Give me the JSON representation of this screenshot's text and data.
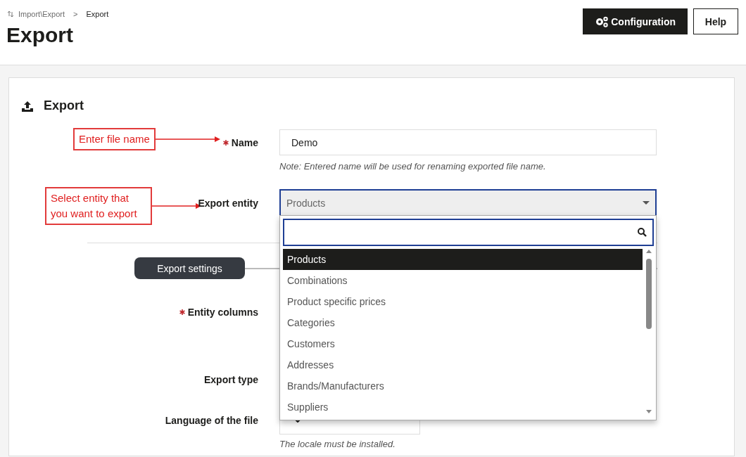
{
  "breadcrumb": {
    "parent": "Import\\Export",
    "separator": ">",
    "current": "Export"
  },
  "page_title": "Export",
  "header_buttons": [
    {
      "label": "Configuration",
      "kind": "primary"
    },
    {
      "label": "Help",
      "kind": "secondary"
    }
  ],
  "card": {
    "title": "Export"
  },
  "annotations": [
    {
      "text": "Enter file name"
    },
    {
      "text": "Select entity that you want to export"
    }
  ],
  "form": {
    "name": {
      "label": "Name",
      "required": true,
      "value": "Demo",
      "note": "Note: Entered name will be used for renaming exported file name."
    },
    "export_entity": {
      "label": "Export entity",
      "required": false,
      "value": "Products",
      "expanded": true,
      "options": [
        {
          "label": "Products",
          "selected": true
        },
        {
          "label": "Combinations",
          "selected": false
        },
        {
          "label": "Product specific prices",
          "selected": false
        },
        {
          "label": "Categories",
          "selected": false
        },
        {
          "label": "Customers",
          "selected": false
        },
        {
          "label": "Addresses",
          "selected": false
        },
        {
          "label": "Brands/Manufacturers",
          "selected": false
        },
        {
          "label": "Suppliers",
          "selected": false
        }
      ]
    },
    "section_label": "Export settings",
    "entity_columns": {
      "label": "Entity columns",
      "required": true
    },
    "export_type": {
      "label": "Export type",
      "required": false
    },
    "language": {
      "label": "Language of the file",
      "required": false,
      "note": "The locale must be installed."
    }
  }
}
